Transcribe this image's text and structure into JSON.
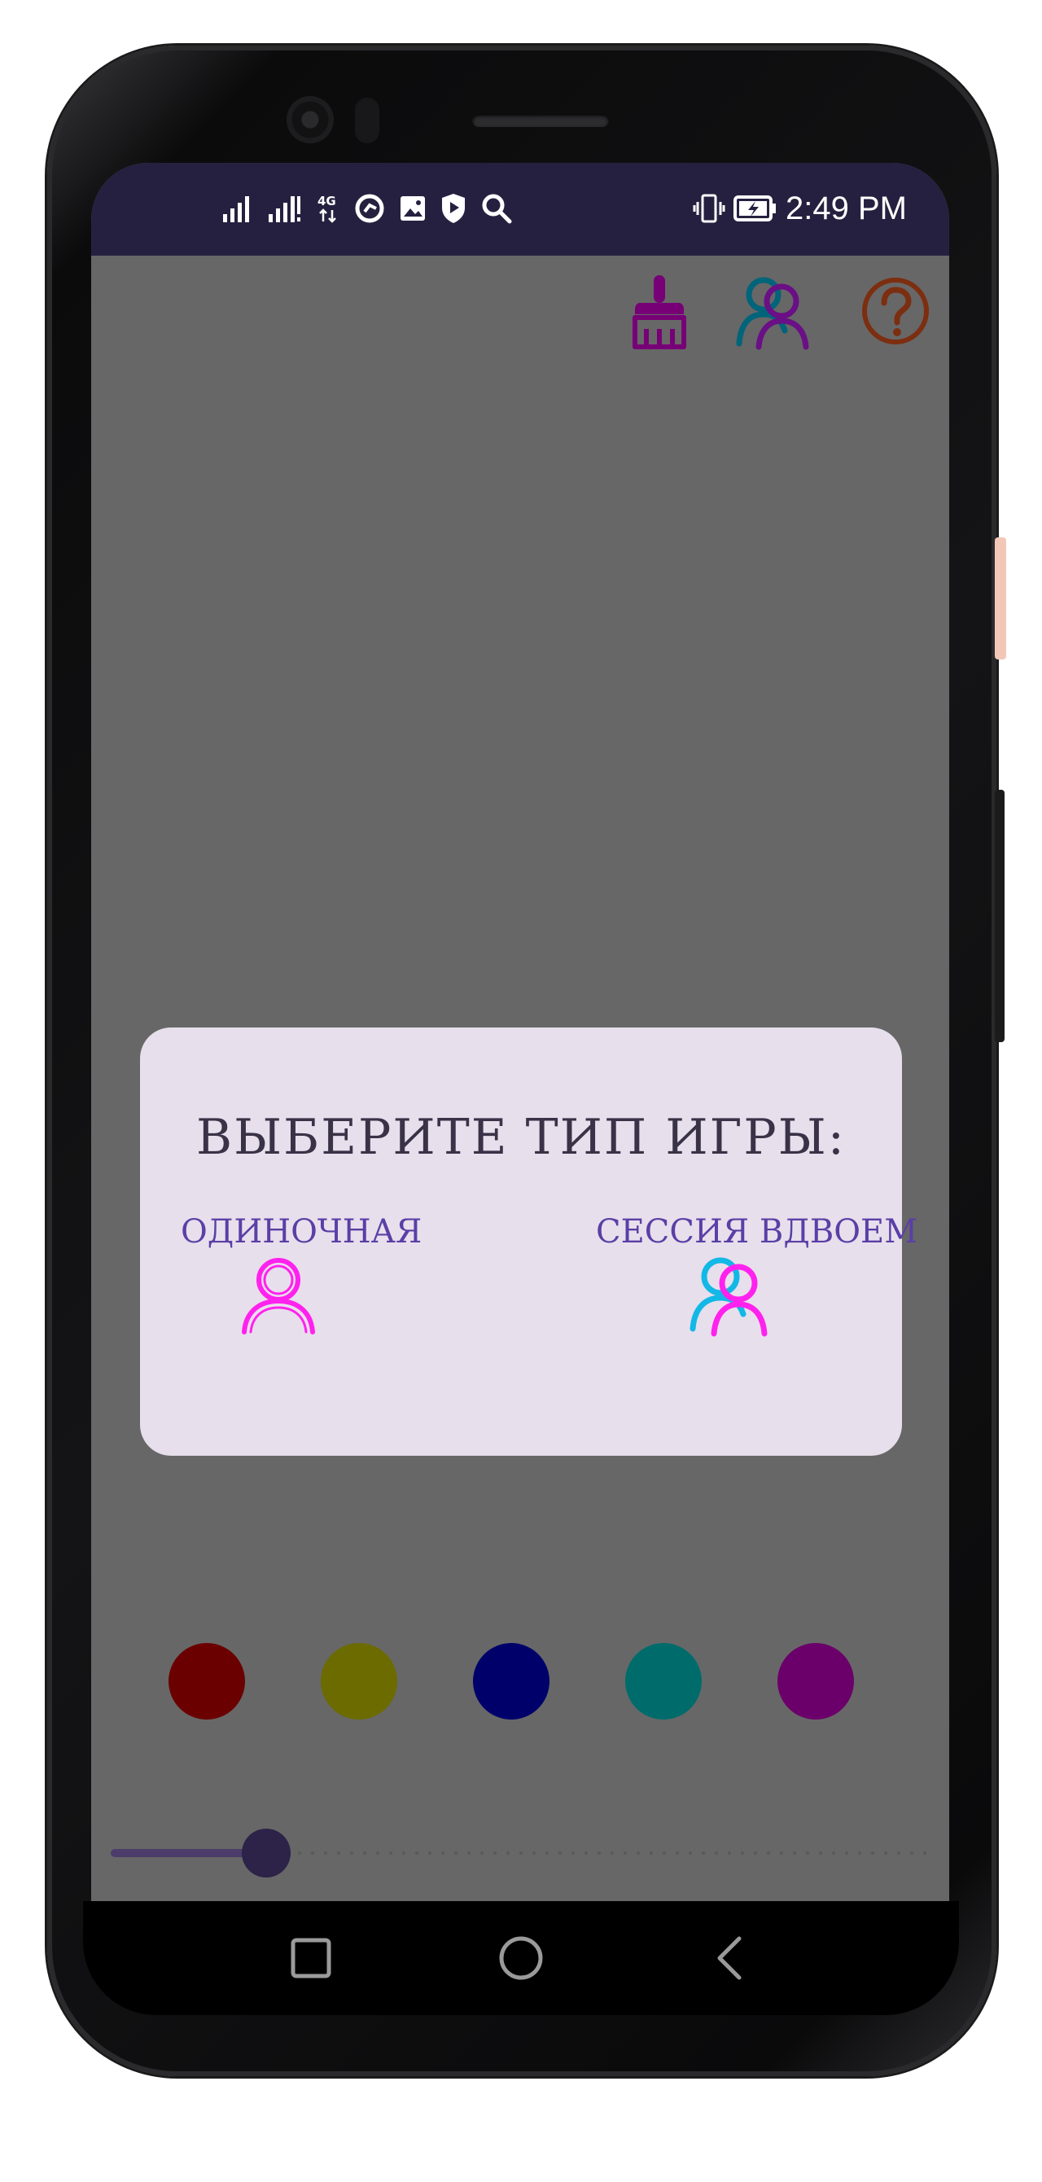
{
  "status_bar": {
    "time": "2:49 PM",
    "left_icons": [
      "signal-icon",
      "signal-icon",
      "network-4g-icon",
      "vpn-icon",
      "image-icon",
      "shield-play-icon",
      "search-icon"
    ],
    "right_icons": [
      "vibrate-icon",
      "battery-charging-icon"
    ]
  },
  "toolbar": {
    "icons": [
      "broom-icon",
      "two-players-icon",
      "help-icon"
    ],
    "colors": {
      "broom": "#770077",
      "players_back": "#00647a",
      "players_front": "#6a0f86",
      "help": "#7c2e10"
    }
  },
  "dialog": {
    "title": "ВЫБЕРИТЕ ТИП ИГРЫ:",
    "options": [
      {
        "label": "ОДИНОЧНАЯ",
        "icon": "single-player-icon"
      },
      {
        "label": "СЕССИЯ ВДВОЕМ",
        "icon": "two-players-icon"
      }
    ],
    "colors": {
      "background": "#e7dfec",
      "label": "#5a3fa6",
      "single_icon": "#ff22ee",
      "duo_back": "#12b8e6",
      "duo_front": "#ff22ee"
    }
  },
  "palette": {
    "colors": [
      "#6b0000",
      "#6b6b00",
      "#00006b",
      "#006b6b",
      "#6b006b"
    ]
  },
  "brush_slider": {
    "value_fraction": 0.19
  },
  "nav_bar": {
    "buttons": [
      "recent-apps-icon",
      "home-icon",
      "back-icon"
    ]
  }
}
